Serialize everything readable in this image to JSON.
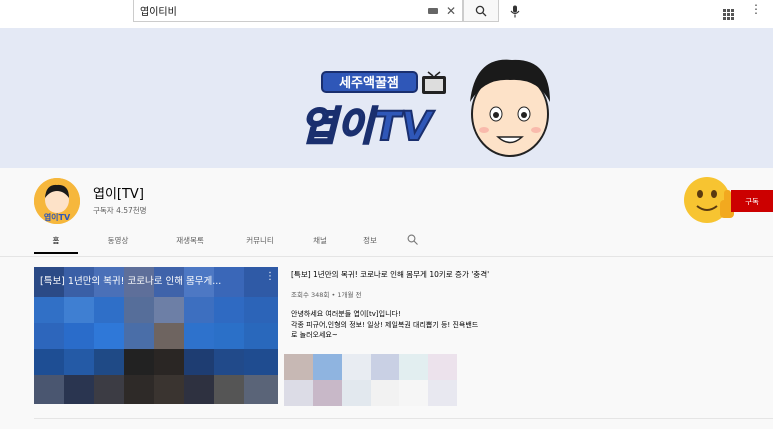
{
  "search": {
    "query": "엽이티비"
  },
  "channel": {
    "name": "엽이[TV]",
    "subscribers": "구독자 4.57천명",
    "subscribe_label": "구독",
    "banner_tagline": "세주액꿀잼",
    "banner_logo": "엽이TV",
    "avatar_text": "엽이TV"
  },
  "tabs": [
    {
      "label": "홈",
      "active": true
    },
    {
      "label": "동영상"
    },
    {
      "label": "재생목록"
    },
    {
      "label": "커뮤니티"
    },
    {
      "label": "채널"
    },
    {
      "label": "정보"
    }
  ],
  "featured": {
    "thumb_title": "[특보] 1년만의 복귀! 코로나로 인해 몸무게...",
    "title": "[특보] 1년만의 복귀! 코로나로 인해 몸무게 10키로 증가 '충격'",
    "meta": "조회수 348회 • 1개월 전",
    "desc": [
      "안녕하세요 여러분들 엽이[tv]입니다!",
      "각종 피규어,인형의 정보! 일상! 제일복권 대리뽑기 등! 진욕밴드",
      "로 놀러오세요~"
    ]
  },
  "colors": {
    "subscribe": "#cc0000",
    "banner_bg": "#e4e9f5",
    "logo_blue": "#2f57b8"
  }
}
